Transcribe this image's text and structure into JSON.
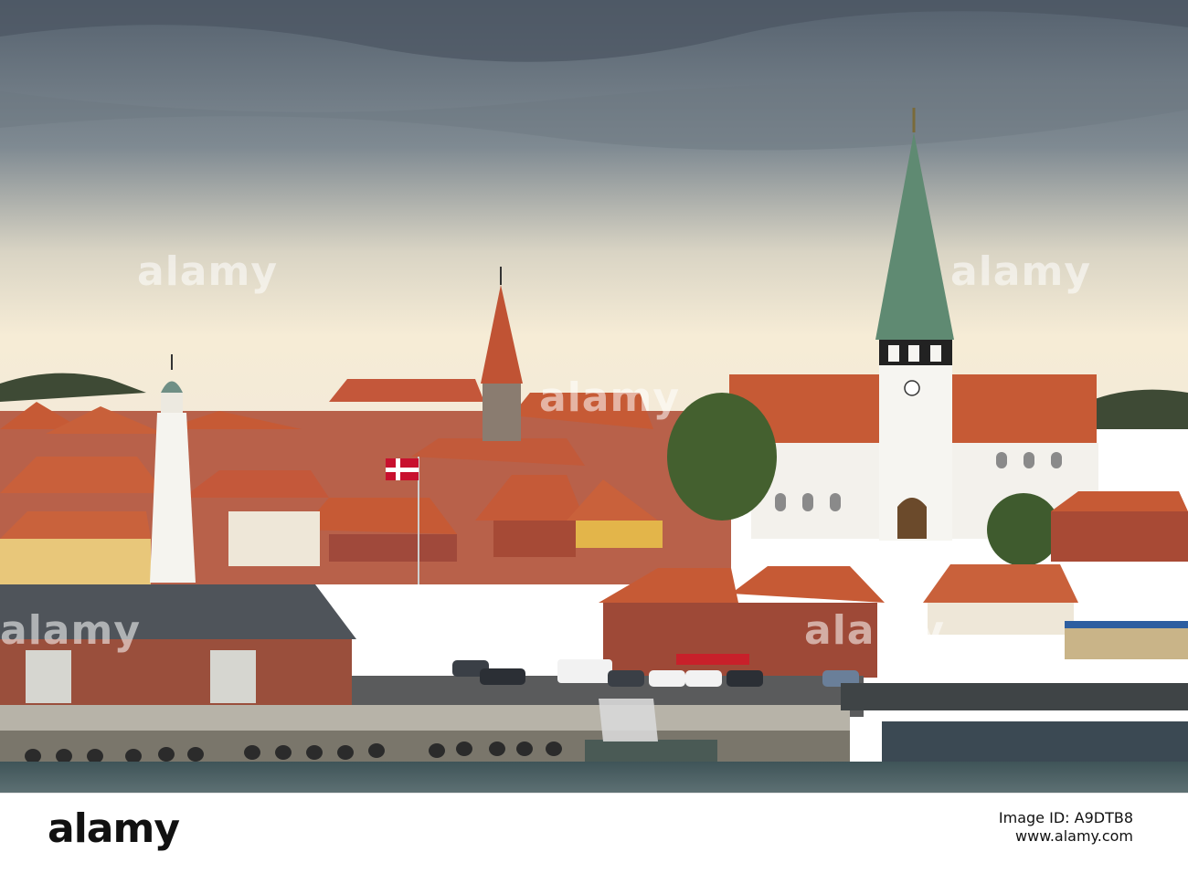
{
  "watermark": {
    "text": "alamy"
  },
  "footer": {
    "brand": "alamy",
    "image_id_label": "Image ID: A9DTB8",
    "site": "www.alamy.com"
  },
  "scene": {
    "description_colors": {
      "sky_top": "#5d6b7a",
      "sky_horizon": "#f6ecd6",
      "roof": "#c65a35",
      "church_wall": "#f3f1ec",
      "spire_copper": "#5f8a72",
      "water": "#4f6266",
      "quay": "#b7b3a8"
    }
  }
}
